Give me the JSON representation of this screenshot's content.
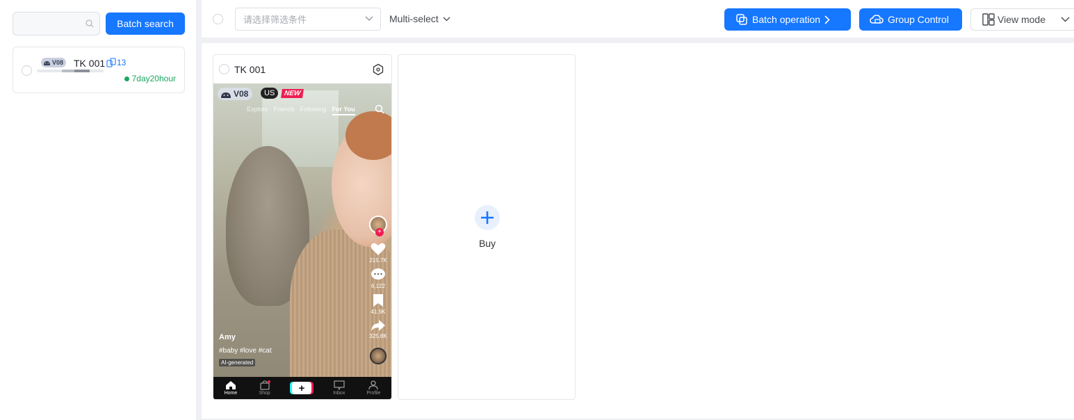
{
  "sidebar": {
    "search": {
      "placeholder": ""
    },
    "batch_search_label": "Batch search",
    "device": {
      "version": "V08",
      "name": "TK 001",
      "sync_count": "13",
      "uptime": "7day20hour"
    }
  },
  "toolbar": {
    "filter_placeholder": "请选择筛选条件",
    "multi_select_label": "Multi-select",
    "batch_operation_label": "Batch operation",
    "group_control_label": "Group Control",
    "view_mode_label": "View mode"
  },
  "phone": {
    "title": "TK 001",
    "screen": {
      "version": "V08",
      "region": "US",
      "new_badge": "NEW",
      "tabs": [
        "Explore",
        "Friends",
        "Following",
        "For You"
      ],
      "likes": "215.7K",
      "comments": "6,122",
      "saves": "41.9K",
      "shares": "325.8K",
      "username": "Amy",
      "hashtags": "#baby #love #cat",
      "ai_label": "AI-generated",
      "nav": [
        "Home",
        "Shop",
        "",
        "Inbox",
        "Profile"
      ]
    }
  },
  "buy": {
    "label": "Buy"
  },
  "colors": {
    "accent": "#1677ff",
    "online": "#1aa760",
    "tiktok_red": "#ee1d52",
    "tiktok_cyan": "#25f4ee"
  }
}
